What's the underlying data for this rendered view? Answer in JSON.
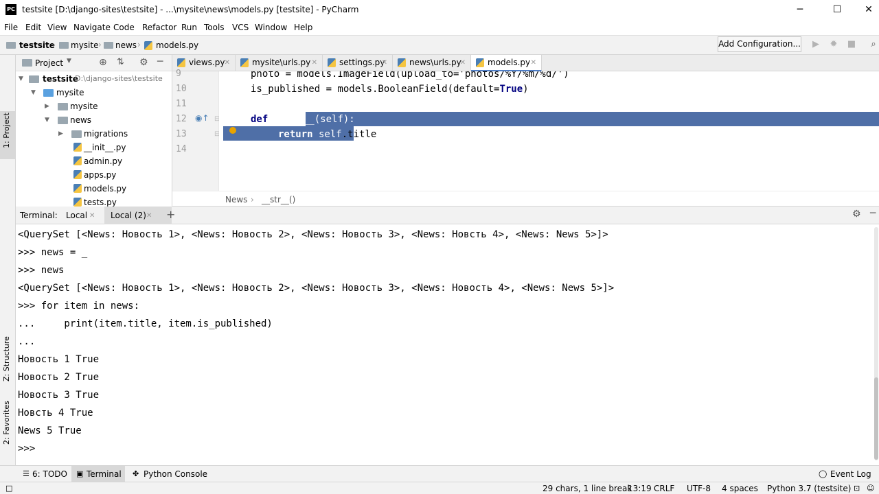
{
  "window": {
    "logo": "PC",
    "title": "testsite [D:\\django-sites\\testsite] - ...\\mysite\\news\\models.py [testsite] - PyCharm",
    "minimize": "─",
    "maximize": "☐",
    "close": "✕"
  },
  "menu": [
    "File",
    "Edit",
    "View",
    "Navigate",
    "Code",
    "Refactor",
    "Run",
    "Tools",
    "VCS",
    "Window",
    "Help"
  ],
  "navbar": {
    "crumbs": [
      "testsite",
      "mysite",
      "news",
      "models.py"
    ],
    "add_config": "Add Configuration..."
  },
  "left_strip": {
    "project_tab": "1: Project",
    "structure_tab": "Z: Structure",
    "favorites_tab": "2: Favorites"
  },
  "project": {
    "header": "Project",
    "root_name": "testsite",
    "root_path": "D:\\django-sites\\testsite",
    "items": [
      "mysite",
      "mysite",
      "news",
      "migrations",
      "__init__.py",
      "admin.py",
      "apps.py",
      "models.py",
      "tests.py"
    ]
  },
  "editor": {
    "tabs": [
      "views.py",
      "mysite\\urls.py",
      "settings.py",
      "news\\urls.py",
      "models.py"
    ],
    "active_tab": "models.py",
    "line_numbers": [
      "9",
      "10",
      "11",
      "12",
      "13",
      "14"
    ],
    "lines": {
      "l9": "photo = models.ImageField(upload_to='photos/%Y/%m/%d/')",
      "l10_a": "is_published = models.BooleanField(default=",
      "l10_b": "True",
      "l10_c": ")",
      "l12_kw": "def",
      "l12_sel": " __str__(self):",
      "l13_kw": "return",
      "l13_self": " self",
      "l13_rest": ".title"
    },
    "breadcrumb": [
      "News",
      "__str__()"
    ]
  },
  "terminal": {
    "label": "Terminal:",
    "tabs": [
      "Local",
      "Local (2)"
    ],
    "add": "+",
    "lines": [
      "<QuerySet [<News: Новость 1>, <News: Новость 2>, <News: Новость 3>, <News: Новсть 4>, <News: News 5>]>",
      ">>> news = _",
      ">>> news",
      "<QuerySet [<News: Новость 1>, <News: Новость 2>, <News: Новость 3>, <News: Новость 4>, <News: News 5>]>",
      ">>> for item in news:",
      "...     print(item.title, item.is_published)",
      "...",
      "Новость 1 True",
      "Новость 2 True",
      "Новость 3 True",
      "Новсть 4 True",
      "News 5 True",
      ">>>"
    ]
  },
  "bottom_tools": {
    "todo": "6: TODO",
    "terminal": "Terminal",
    "python_console": "Python Console",
    "event_log": "Event Log"
  },
  "status": {
    "selection": "29 chars, 1 line break",
    "position": "13:19",
    "line_sep": "CRLF",
    "encoding": "UTF-8",
    "indent": "4 spaces",
    "interpreter": "Python 3.7 (testsite)"
  },
  "colors": {
    "selection": "#4f6fa7",
    "keyword": "#000080",
    "string": "#008000",
    "self": "#94558d",
    "active_tab_underline": "#4d7cc4"
  }
}
